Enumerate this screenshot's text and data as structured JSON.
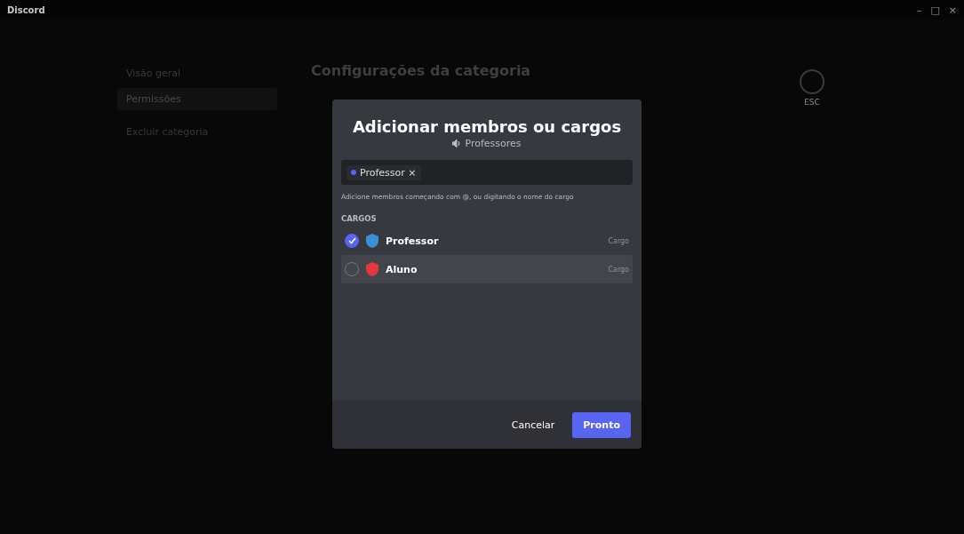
{
  "window": {
    "title": "Discord",
    "controls": [
      "–",
      "□",
      "×"
    ]
  },
  "sidebar": {
    "items": [
      {
        "label": "Visão geral",
        "selected": false
      },
      {
        "label": "Permissões",
        "selected": true
      }
    ],
    "delete_label": "Excluir categoria"
  },
  "content": {
    "title": "Configurações da categoria"
  },
  "close": {
    "label": "ESC"
  },
  "modal": {
    "title": "Adicionar membros ou cargos",
    "channel": "Professores",
    "chips": [
      {
        "label": "Professor",
        "color": "#5865f2"
      }
    ],
    "remove_glyph": "×",
    "hint": "Adicione membros começando com @, ou digitando o nome do cargo",
    "section": "CARGOS",
    "roles": [
      {
        "name": "Professor",
        "type": "Cargo",
        "checked": true,
        "hovered": false,
        "color": "#3b8fd6"
      },
      {
        "name": "Aluno",
        "type": "Cargo",
        "checked": false,
        "hovered": true,
        "color": "#e0393e"
      }
    ],
    "buttons": {
      "cancel": "Cancelar",
      "done": "Pronto"
    }
  }
}
